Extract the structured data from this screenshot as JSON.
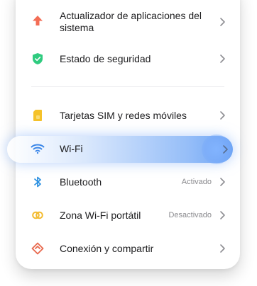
{
  "items": [
    {
      "label": "Actualizador de aplicaciones del sistema",
      "status": "",
      "icon": "arrow-up-icon",
      "color": "#f36d55"
    },
    {
      "label": "Estado de seguridad",
      "status": "",
      "icon": "shield-check-icon",
      "color": "#2fcb7f"
    },
    {
      "label": "Tarjetas SIM y redes móviles",
      "status": "",
      "icon": "sim-card-icon",
      "color": "#f5c22a"
    },
    {
      "label": "Wi-Fi",
      "status": "",
      "icon": "wifi-icon",
      "color": "#3a86e8"
    },
    {
      "label": "Bluetooth",
      "status": "Activado",
      "icon": "bluetooth-icon",
      "color": "#2a8fe0"
    },
    {
      "label": "Zona Wi-Fi portátil",
      "status": "Desactivado",
      "icon": "hotspot-icon",
      "color": "#f3bb2f"
    },
    {
      "label": "Conexión y compartir",
      "status": "",
      "icon": "connection-share-icon",
      "color": "#e86a4f"
    }
  ]
}
